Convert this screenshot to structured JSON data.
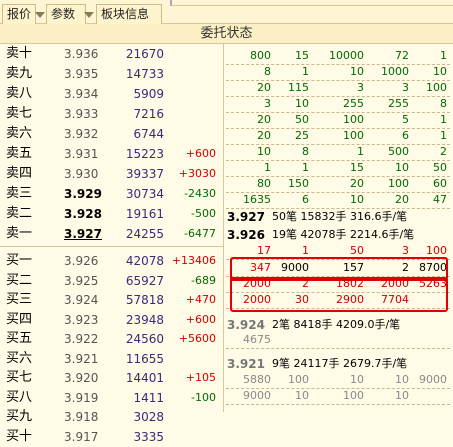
{
  "tabs": [
    {
      "label": "报价"
    },
    {
      "label": "参数"
    },
    {
      "label": "板块信息"
    }
  ],
  "title": "委托状态",
  "sells": [
    {
      "label": "卖十",
      "price": "3.936",
      "vol": "21670",
      "chg": ""
    },
    {
      "label": "卖九",
      "price": "3.935",
      "vol": "14733",
      "chg": ""
    },
    {
      "label": "卖八",
      "price": "3.934",
      "vol": "5909",
      "chg": ""
    },
    {
      "label": "卖七",
      "price": "3.933",
      "vol": "7216",
      "chg": ""
    },
    {
      "label": "卖六",
      "price": "3.932",
      "vol": "6744",
      "chg": ""
    },
    {
      "label": "卖五",
      "price": "3.931",
      "vol": "15223",
      "chg": "+600"
    },
    {
      "label": "卖四",
      "price": "3.930",
      "vol": "39337",
      "chg": "+3030"
    },
    {
      "label": "卖三",
      "price": "3.929",
      "vol": "30734",
      "chg": "-2430"
    },
    {
      "label": "卖二",
      "price": "3.928",
      "vol": "19161",
      "chg": "-500"
    },
    {
      "label": "卖一",
      "price": "3.927",
      "vol": "24255",
      "chg": "-6477"
    }
  ],
  "buys": [
    {
      "label": "买一",
      "price": "3.926",
      "vol": "42078",
      "chg": "+13406"
    },
    {
      "label": "买二",
      "price": "3.925",
      "vol": "65927",
      "chg": "-689"
    },
    {
      "label": "买三",
      "price": "3.924",
      "vol": "57818",
      "chg": "+470"
    },
    {
      "label": "买四",
      "price": "3.923",
      "vol": "23948",
      "chg": "+600"
    },
    {
      "label": "买五",
      "price": "3.922",
      "vol": "24560",
      "chg": "+5600"
    },
    {
      "label": "买六",
      "price": "3.921",
      "vol": "11655",
      "chg": ""
    },
    {
      "label": "买七",
      "price": "3.920",
      "vol": "14401",
      "chg": "+105"
    },
    {
      "label": "买八",
      "price": "3.919",
      "vol": "1411",
      "chg": "-100"
    },
    {
      "label": "买九",
      "price": "3.918",
      "vol": "3028",
      "chg": ""
    },
    {
      "label": "买十",
      "price": "3.917",
      "vol": "3335",
      "chg": ""
    }
  ],
  "queue_sell": [
    [
      "800",
      "15",
      "10000",
      "72",
      "1"
    ],
    [
      "8",
      "1",
      "10",
      "1000",
      "10"
    ],
    [
      "20",
      "115",
      "3",
      "3",
      "100"
    ],
    [
      "3",
      "10",
      "255",
      "255",
      "8"
    ],
    [
      "20",
      "50",
      "100",
      "5",
      "1"
    ],
    [
      "20",
      "25",
      "100",
      "6",
      "1"
    ],
    [
      "10",
      "8",
      "1",
      "500",
      "2"
    ],
    [
      "1",
      "1",
      "15",
      "10",
      "50"
    ],
    [
      "80",
      "150",
      "20",
      "100",
      "60"
    ],
    [
      "1635",
      "6",
      "10",
      "20",
      "47"
    ]
  ],
  "summary_sell": {
    "price": "3.927",
    "rest": "50笔  15832手  316.6手/笔"
  },
  "summary_buy": {
    "price": "3.926",
    "rest": "19笔  42078手  2214.6手/笔"
  },
  "queue_buy": [
    [
      "17",
      "1",
      "50",
      "3",
      "100"
    ],
    [
      "347",
      "9000",
      "157",
      "2",
      "8700"
    ],
    [
      "2000",
      "2",
      "1802",
      "2000",
      "5263"
    ],
    [
      "2000",
      "30",
      "2900",
      "7704",
      ""
    ]
  ],
  "summary_b3": {
    "price": "3.924",
    "rest": "2笔  8418手  4209.0手/笔"
  },
  "queue_b3": [
    [
      "4675",
      "",
      "",
      "",
      ""
    ]
  ],
  "summary_b4": {
    "price": "3.921",
    "rest": "9笔  24117手  2679.7手/笔"
  },
  "queue_b4": [
    [
      "5880",
      "100",
      "10",
      "10",
      "9000"
    ],
    [
      "9000",
      "10",
      "100",
      "10",
      ""
    ]
  ]
}
